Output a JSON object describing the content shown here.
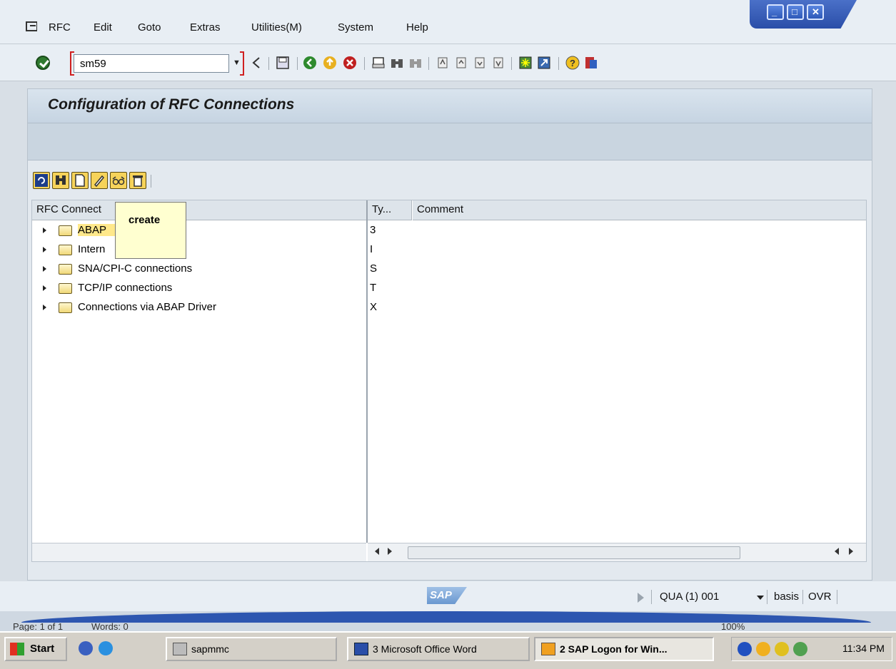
{
  "menu": {
    "items": [
      {
        "label": "RFC",
        "key": "R"
      },
      {
        "label": "Edit",
        "key": "E"
      },
      {
        "label": "Goto",
        "key": "G"
      },
      {
        "label": "Extras",
        "key": "a"
      },
      {
        "label": "Utilities(M)",
        "key": "M"
      },
      {
        "label": "System",
        "key": "y"
      },
      {
        "label": "Help",
        "key": "H"
      }
    ]
  },
  "toolbar": {
    "command_value": "sm59"
  },
  "page": {
    "title": "Configuration of RFC Connections"
  },
  "tree": {
    "col_name": "RFC Connect",
    "col_type": "Ty...",
    "col_comment": "Comment",
    "rows": [
      {
        "label": "ABAP",
        "label_tail": "s",
        "type": "3"
      },
      {
        "label": "Intern",
        "label_tail": "ons",
        "type": "I"
      },
      {
        "label": "SNA/CPI-C connections",
        "type": "S"
      },
      {
        "label": "TCP/IP connections",
        "type": "T"
      },
      {
        "label": "Connections via ABAP Driver",
        "type": "X"
      }
    ]
  },
  "tooltip": {
    "text": "create"
  },
  "status": {
    "system": "QUA (1) 001",
    "user": "basis",
    "mode": "OVR",
    "logo": "SAP"
  },
  "word_status": {
    "page": "Page: 1 of 1",
    "words": "Words: 0",
    "zoom": "100%"
  },
  "taskbar": {
    "start": "Start",
    "tasks": [
      {
        "label": "sapmmc"
      },
      {
        "label": "3 Microsoft Office Word"
      },
      {
        "label": "2 SAP Logon for Win..."
      }
    ],
    "clock": "11:34 PM"
  }
}
